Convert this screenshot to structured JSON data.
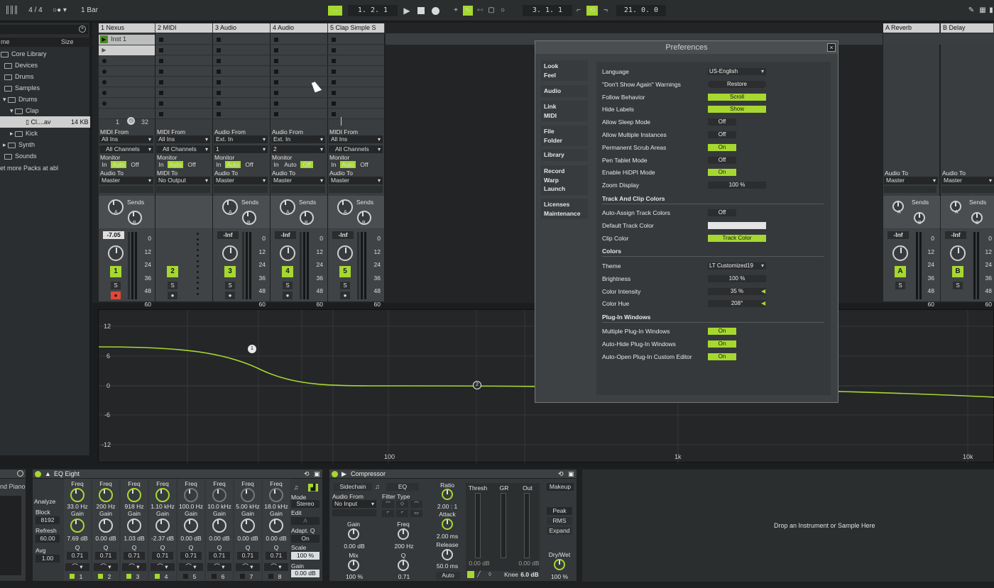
{
  "transport": {
    "signature": "4 / 4",
    "quantize": "1 Bar",
    "position": "1.  2.  1",
    "loop_start": "3.  1.  1",
    "loop_length": "21.  0.  0"
  },
  "browser": {
    "col_name": "me",
    "col_size": "Size",
    "items": [
      {
        "label": "Core Library"
      },
      {
        "label": "Devices"
      },
      {
        "label": "Drums"
      },
      {
        "label": "Samples"
      },
      {
        "label": "Drums"
      },
      {
        "label": "Clap"
      },
      {
        "label": "Cl....av",
        "size": "14 KB"
      },
      {
        "label": "Kick"
      },
      {
        "label": "Synth"
      },
      {
        "label": "Sounds"
      }
    ],
    "more_packs": "et more Packs at abl"
  },
  "tracks": [
    {
      "name": "1 Nexus",
      "clip": "Inst 1",
      "in_lbl": "MIDI From",
      "in_src": "All Ins",
      "in_ch": "All Channels",
      "out_lbl": "Audio To",
      "out": "Master",
      "vol": "-7.05",
      "num": "1"
    },
    {
      "name": "2 MIDI",
      "in_lbl": "MIDI From",
      "in_src": "All Ins",
      "in_ch": "All Channels",
      "out_lbl": "MIDI To",
      "out": "No Output",
      "num": "2"
    },
    {
      "name": "3 Audio",
      "in_lbl": "Audio From",
      "in_src": "Ext. In",
      "in_ch": "1",
      "out_lbl": "Audio To",
      "out": "Master",
      "vol": "-Inf",
      "num": "3"
    },
    {
      "name": "4 Audio",
      "in_lbl": "Audio From",
      "in_src": "Ext. In",
      "in_ch": "2",
      "out_lbl": "Audio To",
      "out": "Master",
      "vol": "-Inf",
      "num": "4"
    },
    {
      "name": "5 Clap Simple S",
      "in_lbl": "MIDI From",
      "in_src": "All Ins",
      "in_ch": "All Channels",
      "out_lbl": "Audio To",
      "out": "Master",
      "vol": "-Inf",
      "num": "5"
    }
  ],
  "returns": [
    {
      "name": "A Reverb",
      "out_lbl": "Audio To",
      "out": "Master",
      "vol": "-Inf",
      "letter": "A"
    },
    {
      "name": "B Delay",
      "out_lbl": "Audio To",
      "out": "Master",
      "vol": "-Inf",
      "letter": "B"
    }
  ],
  "mixer": {
    "monitor": "Monitor",
    "mon_in": "In",
    "mon_auto": "Auto",
    "mon_off": "Off",
    "sends": "Sends",
    "send_a": "A",
    "send_b": "B",
    "solo": "S",
    "scale": [
      "0",
      "12",
      "24",
      "36",
      "48",
      "60"
    ],
    "scene_start": "1",
    "scene_len": "32"
  },
  "graph": {
    "y_labels": [
      "12",
      "6",
      "0",
      "-6",
      "-12"
    ],
    "x_labels": [
      "100",
      "1k",
      "10k"
    ],
    "points": [
      "1",
      "2"
    ]
  },
  "eq_eight": {
    "title": "EQ Eight",
    "analyze": "Analyze",
    "block": "Block",
    "block_val": "8192",
    "refresh": "Refresh",
    "refresh_val": "60.00",
    "avg": "Avg",
    "avg_val": "1.00",
    "bands": [
      {
        "freq": "33.0 Hz",
        "gain": "7.69 dB",
        "q": "0.71",
        "n": "1"
      },
      {
        "freq": "200 Hz",
        "gain": "0.00 dB",
        "q": "0.71",
        "n": "2"
      },
      {
        "freq": "918 Hz",
        "gain": "1.03 dB",
        "q": "0.71",
        "n": "3"
      },
      {
        "freq": "1.10 kHz",
        "gain": "-2.37 dB",
        "q": "0.71",
        "n": "4"
      },
      {
        "freq": "100.0 Hz",
        "gain": "0.00 dB",
        "q": "0.71",
        "n": "5"
      },
      {
        "freq": "10.0 kHz",
        "gain": "0.00 dB",
        "q": "0.71",
        "n": "6"
      },
      {
        "freq": "5.00 kHz",
        "gain": "0.00 dB",
        "q": "0.71",
        "n": "7"
      },
      {
        "freq": "18.0 kHz",
        "gain": "0.00 dB",
        "q": "0.71",
        "n": "8"
      }
    ],
    "lbl_freq": "Freq",
    "lbl_gain": "Gain",
    "lbl_q": "Q",
    "mode": "Mode",
    "mode_val": "Stereo",
    "edit": "Edit",
    "edit_val": "A",
    "adapt_q": "Adapt. Q",
    "adapt_val": "On",
    "scale": "Scale",
    "scale_val": "100 %",
    "out_gain": "Gain",
    "out_gain_val": "0.00 dB",
    "left_label": "nd Piano"
  },
  "compressor": {
    "title": "Compressor",
    "sidechain": "Sidechain",
    "eq": "EQ",
    "audio_from": "Audio From",
    "audio_src": "No Input",
    "filter_type": "Filter Type",
    "gain": "Gain",
    "gain_val": "0.00 dB",
    "mix": "Mix",
    "mix_val": "100 %",
    "freq": "Freq",
    "freq_val": "200 Hz",
    "q": "Q",
    "q_val": "0.71",
    "ratio": "Ratio",
    "ratio_val": "2.00 : 1",
    "attack": "Attack",
    "attack_val": "2.00 ms",
    "release": "Release",
    "release_val": "50.0 ms",
    "auto": "Auto",
    "thresh": "Thresh",
    "gr": "GR",
    "out": "Out",
    "thresh_val": "0.00 dB",
    "out_val": "0.00 dB",
    "knee": "Knee",
    "knee_val": "6.0 dB",
    "makeup": "Makeup",
    "peak": "Peak",
    "rms": "RMS",
    "expand": "Expand",
    "drywet": "Dry/Wet",
    "drywet_val": "100 %"
  },
  "drop_zone": "Drop an Instrument or Sample Here",
  "preferences": {
    "title": "Preferences",
    "tabs": [
      {
        "lines": [
          "Look",
          "Feel"
        ]
      },
      {
        "lines": [
          "Audio"
        ]
      },
      {
        "lines": [
          "Link",
          "MIDI"
        ]
      },
      {
        "lines": [
          "File",
          "Folder"
        ]
      },
      {
        "lines": [
          "Library"
        ]
      },
      {
        "lines": [
          "Record",
          "Warp",
          "Launch"
        ]
      },
      {
        "lines": [
          "Licenses",
          "Maintenance"
        ]
      }
    ],
    "rows": [
      {
        "label": "Language",
        "value": "US-English",
        "kind": "select"
      },
      {
        "label": "\"Don't Show Again\" Warnings",
        "value": "Restore",
        "kind": "button"
      },
      {
        "label": "Follow Behavior",
        "value": "Scroll",
        "kind": "on"
      },
      {
        "label": "Hide Labels",
        "value": "Show",
        "kind": "on"
      },
      {
        "label": "Allow Sleep Mode",
        "value": "Off",
        "kind": "off"
      },
      {
        "label": "Allow Multiple Instances",
        "value": "Off",
        "kind": "off"
      },
      {
        "label": "Permanent Scrub Areas",
        "value": "On",
        "kind": "on"
      },
      {
        "label": "Pen Tablet Mode",
        "value": "Off",
        "kind": "off"
      },
      {
        "label": "Enable HiDPI Mode",
        "value": "On",
        "kind": "on"
      },
      {
        "label": "Zoom Display",
        "value": "100 %",
        "kind": "num"
      }
    ],
    "sec_track": "Track And Clip Colors",
    "rows_track": [
      {
        "label": "Auto-Assign Track Colors",
        "value": "Off",
        "kind": "off"
      },
      {
        "label": "Default Track Color",
        "value": "",
        "kind": "swatch"
      },
      {
        "label": "Clip Color",
        "value": "Track Color",
        "kind": "on"
      }
    ],
    "sec_colors": "Colors",
    "rows_colors": [
      {
        "label": "Theme",
        "value": "LT Customized19",
        "kind": "select"
      },
      {
        "label": "Brightness",
        "value": "100 %",
        "kind": "num"
      },
      {
        "label": "Color Intensity",
        "value": "35 %",
        "kind": "num"
      },
      {
        "label": "Color Hue",
        "value": "208°",
        "kind": "num"
      }
    ],
    "sec_plugin": "Plug-In Windows",
    "rows_plugin": [
      {
        "label": "Multiple Plug-In Windows",
        "value": "On",
        "kind": "on"
      },
      {
        "label": "Auto-Hide Plug-In Windows",
        "value": "On",
        "kind": "on"
      },
      {
        "label": "Auto-Open Plug-In Custom Editor",
        "value": "On",
        "kind": "on"
      }
    ]
  },
  "colors": {
    "accent": "#a6d830",
    "panel": "#3a3d3f",
    "background": "#1b1d1e"
  }
}
